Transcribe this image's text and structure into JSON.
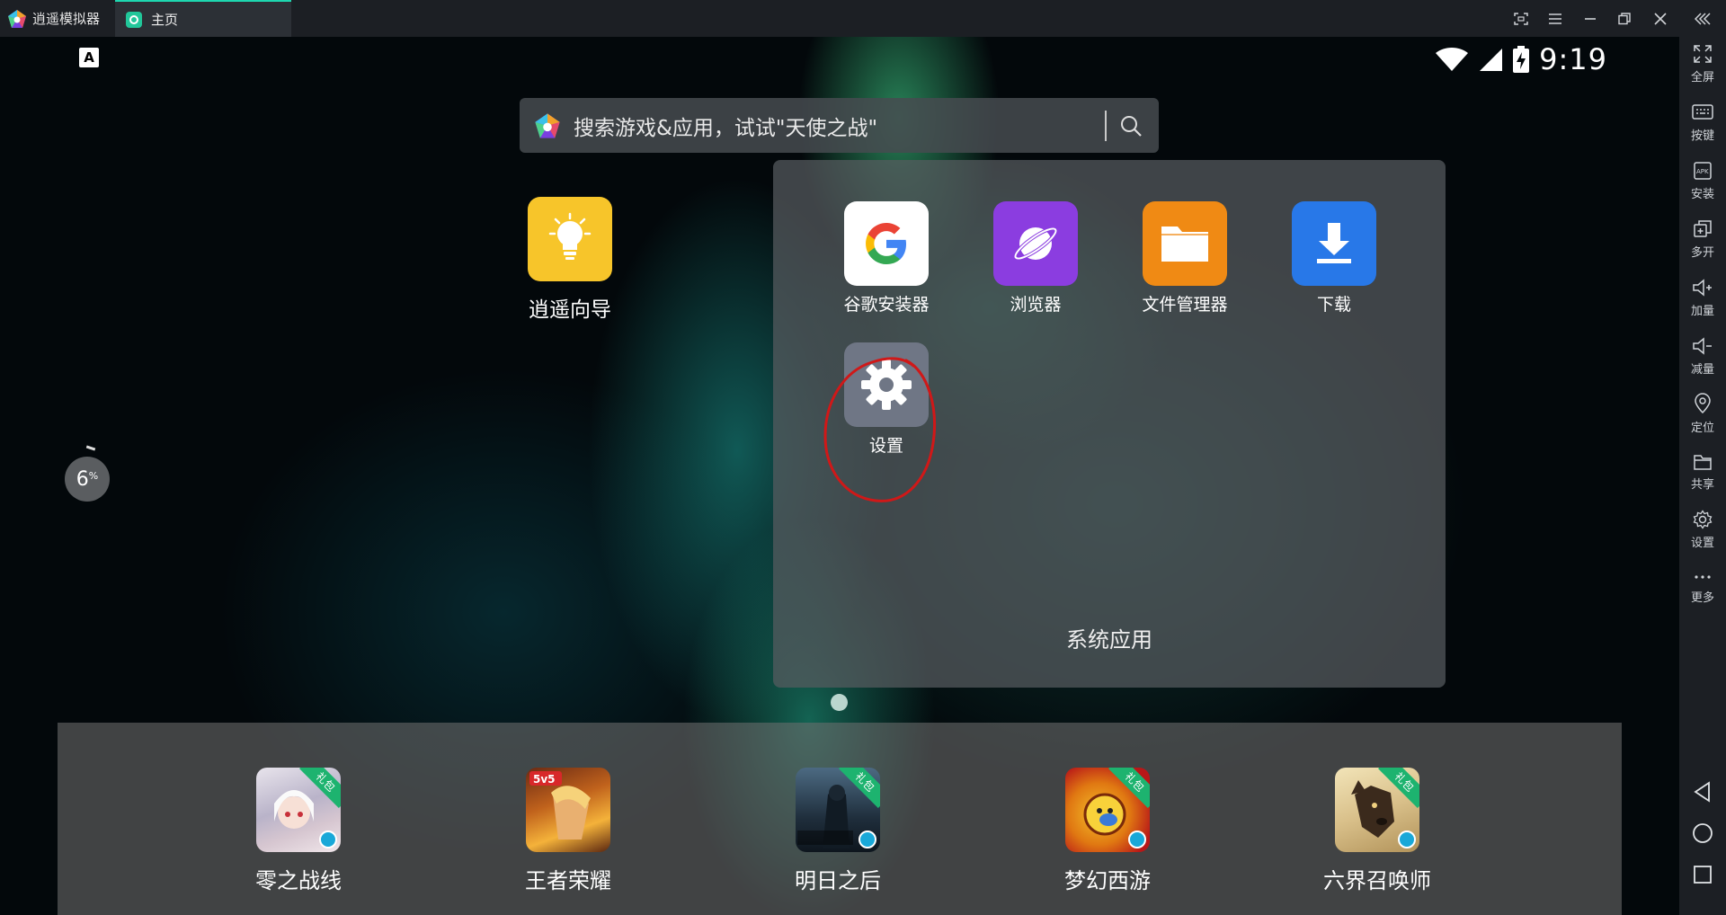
{
  "titlebar": {
    "app_name": "逍遥模拟器",
    "tab_label": "主页",
    "controls": [
      "capture-icon",
      "menu-icon",
      "minimize-icon",
      "restore-icon",
      "close-icon",
      "collapse-icon"
    ]
  },
  "status_bar": {
    "keyboard_indicator": "A",
    "time": "9:19"
  },
  "search": {
    "placeholder": "搜索游戏&应用，试试\"天使之战\""
  },
  "progress": {
    "value": "6",
    "unit": "%"
  },
  "home_apps": [
    {
      "label": "逍遥向导",
      "icon": "lightbulb-icon",
      "color": "#f7c52a"
    }
  ],
  "folder": {
    "title": "系统应用",
    "apps": [
      {
        "label": "谷歌安装器",
        "icon": "google-icon",
        "color": "#ffffff"
      },
      {
        "label": "浏览器",
        "icon": "planet-icon",
        "color": "#8b3de0"
      },
      {
        "label": "文件管理器",
        "icon": "folder-icon",
        "color": "#f08a14"
      },
      {
        "label": "下载",
        "icon": "download-icon",
        "color": "#2878e8"
      },
      {
        "label": "设置",
        "icon": "gear-icon",
        "color": "#6f7685"
      }
    ]
  },
  "dock": {
    "games": [
      {
        "label": "零之战线",
        "badge": "礼包"
      },
      {
        "label": "王者荣耀",
        "badge": ""
      },
      {
        "label": "明日之后",
        "badge": "礼包"
      },
      {
        "label": "梦幻西游",
        "badge": "礼包"
      },
      {
        "label": "六界召唤师",
        "badge": "礼包"
      }
    ]
  },
  "sidebar": {
    "items": [
      {
        "label": "全屏",
        "icon": "fullscreen-icon"
      },
      {
        "label": "按键",
        "icon": "keyboard-icon"
      },
      {
        "label": "安装",
        "icon": "apk-install-icon"
      },
      {
        "label": "多开",
        "icon": "multi-instance-icon"
      },
      {
        "label": "加量",
        "icon": "volume-up-icon"
      },
      {
        "label": "减量",
        "icon": "volume-down-icon"
      },
      {
        "label": "定位",
        "icon": "location-icon"
      },
      {
        "label": "共享",
        "icon": "shared-folder-icon"
      },
      {
        "label": "设置",
        "icon": "settings-icon"
      },
      {
        "label": "更多",
        "icon": "more-icon"
      }
    ],
    "nav": [
      "back-icon",
      "home-icon",
      "recents-icon"
    ]
  },
  "colors": {
    "accent": "#1ed7b0",
    "annotation": "#d01818"
  }
}
